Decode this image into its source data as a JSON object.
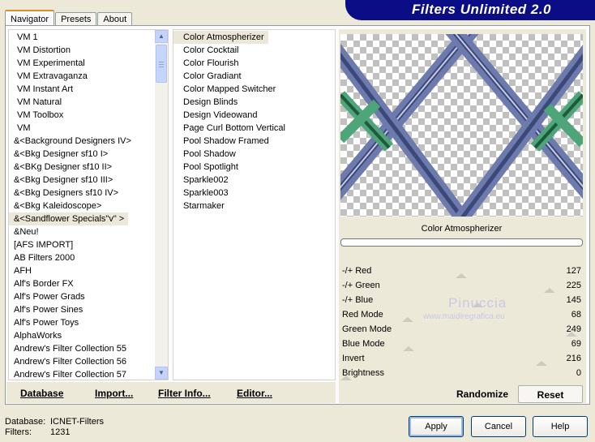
{
  "tabs": [
    "Navigator",
    "Presets",
    "About"
  ],
  "banner_title": "Filters Unlimited 2.0",
  "categories": [
    "VM 1",
    "VM Distortion",
    "VM Experimental",
    "VM Extravaganza",
    "VM Instant Art",
    "VM Natural",
    "VM Toolbox",
    "VM",
    "&<Background Designers IV>",
    "&<Bkg Designer sf10 I>",
    "&<BKg Designer sf10 II>",
    "&<Bkg Designer sf10 III>",
    "&<Bkg Designers sf10 IV>",
    "&<Bkg Kaleidoscope>",
    "&<Sandflower Specials\"v\" >",
    "&Neu!",
    "[AFS IMPORT]",
    "AB Filters 2000",
    "AFH",
    "Alf's Border FX",
    "Alf's Power Grads",
    "Alf's Power Sines",
    "Alf's Power Toys",
    "AlphaWorks",
    "Andrew's Filter Collection 55",
    "Andrew's Filter Collection 56",
    "Andrew's Filter Collection 57"
  ],
  "selected_category": "&<Sandflower Specials\"v\" >",
  "filters": [
    "Color Atmospherizer",
    "Color Cocktail",
    "Color Flourish",
    "Color Gradiant",
    "Color Mapped Switcher",
    "Design Blinds",
    "Design Videowand",
    "Page Curl Bottom Vertical",
    "Pool Shadow Framed",
    "Pool Shadow",
    "Pool Spotlight",
    "Sparkle002",
    "Sparkle003",
    "Starmaker"
  ],
  "selected_filter": "Color Atmospherizer",
  "filter_name": "Color Atmospherizer",
  "params": [
    {
      "label": "-/+ Red",
      "value": "127",
      "level": 127
    },
    {
      "label": "-/+ Green",
      "value": "225",
      "level": 225
    },
    {
      "label": "-/+ Blue",
      "value": "145",
      "level": 145
    },
    {
      "label": "Red Mode",
      "value": "68",
      "level": 68
    },
    {
      "label": "Green Mode",
      "value": "249",
      "level": 249
    },
    {
      "label": "Blue Mode",
      "value": "69",
      "level": 69
    },
    {
      "label": "Invert",
      "value": "216",
      "level": 216
    },
    {
      "label": "Brightness",
      "value": "0",
      "level": 0
    }
  ],
  "watermark": {
    "name": "Pinuccia",
    "url": "www.maidiregrafica.eu"
  },
  "bottom_buttons": {
    "database": "Database",
    "import": "Import...",
    "filter_info": "Filter Info...",
    "editor": "Editor..."
  },
  "randomize_label": "Randomize",
  "reset_label": "Reset",
  "info": {
    "database_label": "Database:",
    "database_value": "ICNET-Filters",
    "filters_label": "Filters:",
    "filters_value": "1231"
  },
  "dialog_buttons": {
    "apply": "Apply",
    "cancel": "Cancel",
    "help": "Help"
  },
  "colors": {
    "banner": "#0a0d85",
    "tab_highlight": "#e68b2c",
    "preview_blue": "#5a6aa0",
    "preview_green": "#3d9a6a"
  }
}
